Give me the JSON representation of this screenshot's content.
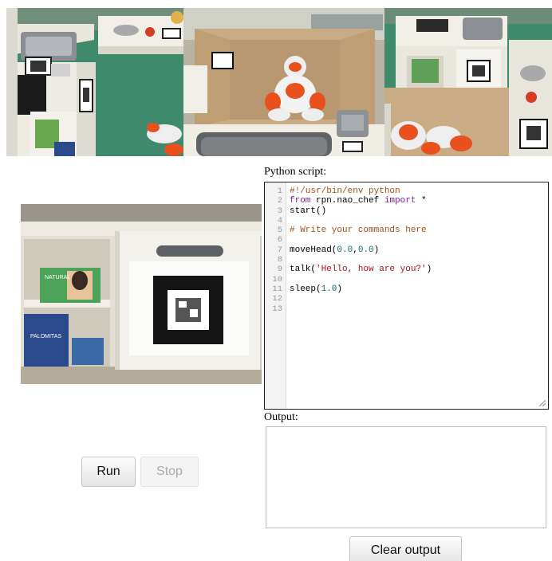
{
  "cameras": [
    {
      "name": "camera-feed-kitchen-left",
      "description_icon": "camera-feed"
    },
    {
      "name": "camera-feed-robot-top",
      "description_icon": "camera-feed"
    },
    {
      "name": "camera-feed-kitchen-right",
      "description_icon": "camera-feed"
    },
    {
      "name": "camera-feed-robot-view",
      "description_icon": "camera-feed"
    }
  ],
  "script": {
    "label": "Python script:",
    "lines": [
      {
        "n": "1",
        "parts": [
          {
            "t": "#!/usr/bin/env python",
            "c": "cm"
          }
        ]
      },
      {
        "n": "2",
        "parts": [
          {
            "t": "from",
            "c": "kw"
          },
          {
            "t": " rpn.nao_chef ",
            "c": ""
          },
          {
            "t": "import",
            "c": "kw"
          },
          {
            "t": " *",
            "c": ""
          }
        ]
      },
      {
        "n": "3",
        "parts": [
          {
            "t": "start()",
            "c": ""
          }
        ]
      },
      {
        "n": "4",
        "parts": []
      },
      {
        "n": "5",
        "parts": [
          {
            "t": "# Write your commands here",
            "c": "cm"
          }
        ]
      },
      {
        "n": "6",
        "parts": []
      },
      {
        "n": "7",
        "parts": [
          {
            "t": "moveHead(",
            "c": ""
          },
          {
            "t": "0.0",
            "c": "num"
          },
          {
            "t": ",",
            "c": ""
          },
          {
            "t": "0.0",
            "c": "num"
          },
          {
            "t": ")",
            "c": ""
          }
        ]
      },
      {
        "n": "8",
        "parts": []
      },
      {
        "n": "9",
        "parts": [
          {
            "t": "talk(",
            "c": ""
          },
          {
            "t": "'Hello, how are you?'",
            "c": "str"
          },
          {
            "t": ")",
            "c": ""
          }
        ]
      },
      {
        "n": "10",
        "parts": []
      },
      {
        "n": "11",
        "parts": [
          {
            "t": "sleep(",
            "c": ""
          },
          {
            "t": "1.0",
            "c": "num"
          },
          {
            "t": ")",
            "c": ""
          }
        ]
      },
      {
        "n": "12",
        "parts": []
      },
      {
        "n": "13",
        "parts": []
      }
    ]
  },
  "output": {
    "label": "Output:",
    "value": ""
  },
  "buttons": {
    "run": "Run",
    "stop": "Stop",
    "clear": "Clear output"
  },
  "camera_text": {
    "cereal_box": "PALOMITAS",
    "tea_box": "NATURAL"
  },
  "colors": {
    "robot_orange": "#e8501e",
    "robot_white": "#eeeeee",
    "counter_green": "#3f8a6c",
    "cabinet_white": "#f2f0ea",
    "plywood": "#c9ab86",
    "comment": "#a0501a",
    "keyword": "#7a1f9e",
    "string": "#a31515",
    "number": "#1a6b6b"
  }
}
